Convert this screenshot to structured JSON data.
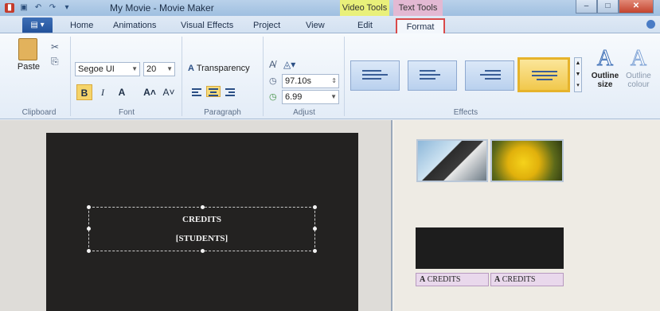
{
  "window": {
    "title": "My Movie - Movie Maker"
  },
  "contextual_tabs": {
    "video_tools": "Video Tools",
    "text_tools": "Text Tools"
  },
  "tabs": [
    {
      "label": "Home"
    },
    {
      "label": "Animations"
    },
    {
      "label": "Visual Effects"
    },
    {
      "label": "Project"
    },
    {
      "label": "View"
    },
    {
      "label": "Edit"
    },
    {
      "label": "Format"
    }
  ],
  "ribbon": {
    "clipboard": {
      "paste_label": "Paste",
      "group_label": "Clipboard"
    },
    "font": {
      "family": "Segoe UI",
      "size": "20",
      "bold": "B",
      "italic": "I",
      "color_a": "A",
      "grow": "A˄",
      "shrink": "A˅",
      "group_label": "Font"
    },
    "paragraph": {
      "transparency_label": "Transparency",
      "group_label": "Paragraph"
    },
    "adjust": {
      "start_time": "97.10s",
      "duration": "6.99",
      "group_label": "Adjust"
    },
    "effects": {
      "group_label": "Effects",
      "outline_size": "Outline size",
      "outline_colour": "Outline colour"
    }
  },
  "preview": {
    "line1": "CREDITS",
    "line2": "[STUDENTS]"
  },
  "storyboard": {
    "caption1": "CREDITS",
    "caption2": "CREDITS"
  },
  "colors": {
    "accent_tab_border": "#d94a4a",
    "video_tools": "#e9f07a",
    "text_tools": "#e3b9d3"
  }
}
